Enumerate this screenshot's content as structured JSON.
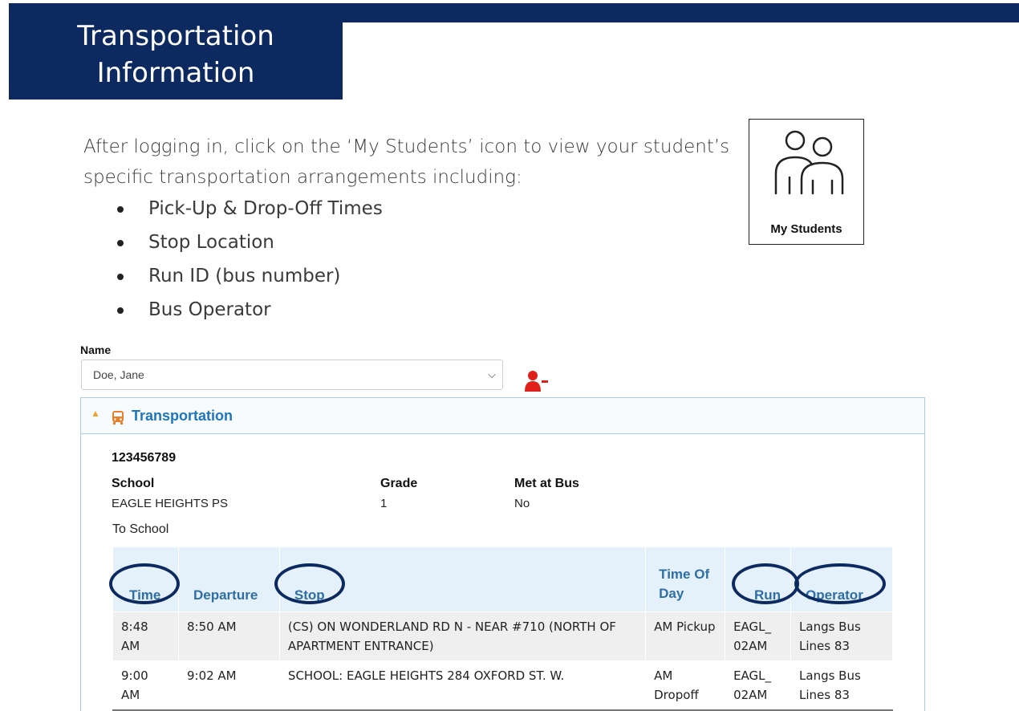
{
  "header": {
    "title_line1": "Transportation",
    "title_line2": "Information"
  },
  "intro": {
    "text_line1": "After logging in, click on the ‘My Students’ icon to view your student’s",
    "text_line2": "specific transportation arrangements including:",
    "bullets": [
      "Pick-Up & Drop-Off Times",
      "Stop Location",
      "Run ID (bus number)",
      "Bus Operator"
    ]
  },
  "my_students_card": {
    "label": "My Students",
    "icon": "two-people-icon"
  },
  "name_field": {
    "label": "Name",
    "value": "Doe, Jane",
    "remove_icon": "remove-user-icon"
  },
  "transportation_panel": {
    "title": "Transportation",
    "student_id": "123456789",
    "school_label": "School",
    "school_value": "EAGLE HEIGHTS PS",
    "grade_label": "Grade",
    "grade_value": "1",
    "met_at_bus_label": "Met at Bus",
    "met_at_bus_value": "No",
    "direction": "To School",
    "table": {
      "headers": {
        "time": "Time",
        "departure": "Departure",
        "stop": "Stop",
        "time_of_day": "Time Of Day",
        "run": "Run",
        "operator": "Operator"
      },
      "rows": [
        {
          "time": "8:48 AM",
          "departure": "8:50 AM",
          "stop": "(CS) ON WONDERLAND RD N - NEAR #710 (NORTH OF APARTMENT ENTRANCE)",
          "time_of_day": "AM Pickup",
          "run": "EAGL_ 02AM",
          "operator": "Langs Bus Lines 83"
        },
        {
          "time": "9:00 AM",
          "departure": "9:02 AM",
          "stop": "SCHOOL: EAGLE HEIGHTS 284 OXFORD ST. W.",
          "time_of_day": "AM Dropoff",
          "run": "EAGL_ 02AM",
          "operator": "Langs Bus Lines 83"
        }
      ]
    }
  },
  "colors": {
    "navy": "#0c2a5f",
    "link_blue": "#1e74bd",
    "header_bg": "#e4f1fb",
    "alert_red": "#e0201b",
    "accent_orange": "#f0a22e"
  }
}
